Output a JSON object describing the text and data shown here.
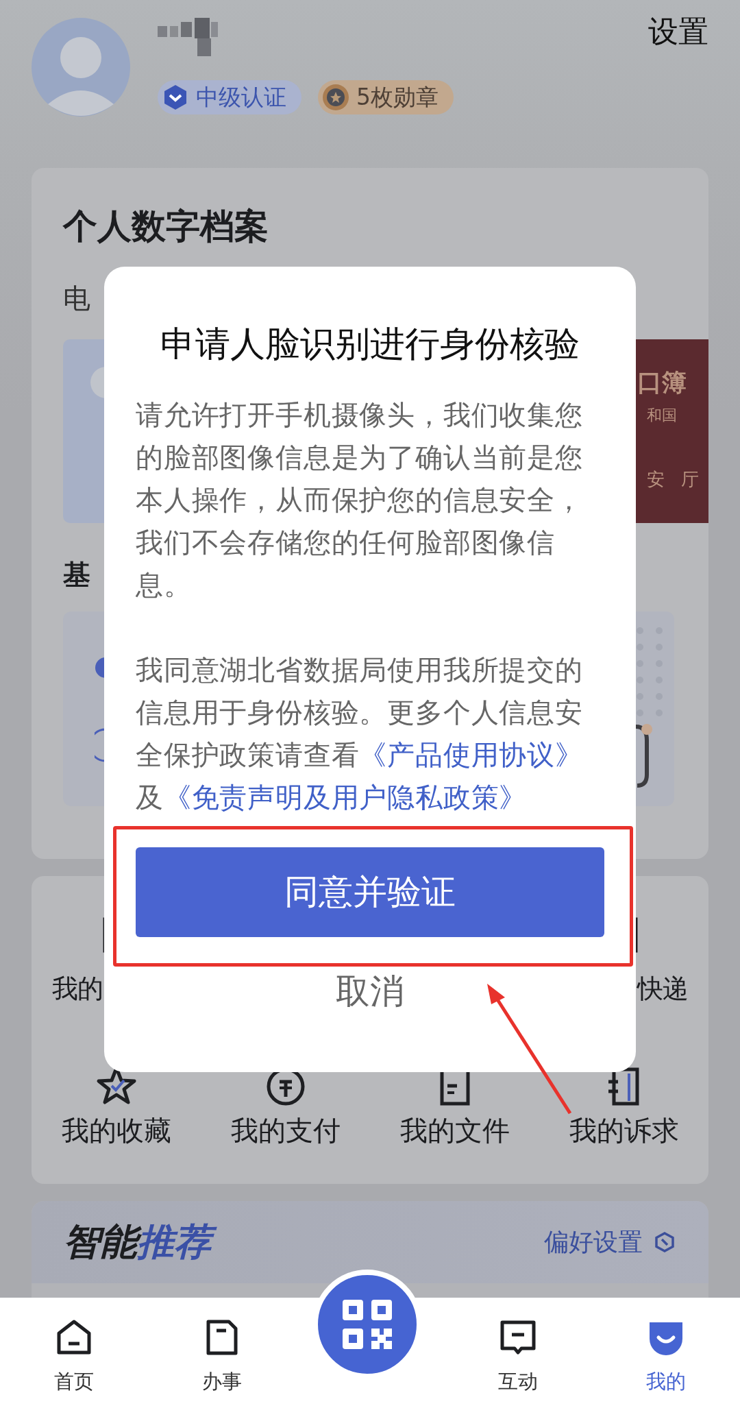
{
  "header": {
    "settings": "设置",
    "badges": [
      {
        "kind": "certification",
        "label": "中级认证"
      },
      {
        "kind": "medal",
        "label": "5枚勋章"
      }
    ]
  },
  "archive": {
    "title": "个人数字档案",
    "section_label": "电",
    "household_card": [
      "口簿",
      "和国",
      "安 厅"
    ],
    "subsection_label": "基"
  },
  "services": {
    "row_1": [
      "我的",
      "快递"
    ],
    "row_2": [
      "我的收藏",
      "我的支付",
      "我的文件",
      "我的诉求"
    ]
  },
  "recommend": {
    "title": [
      {
        "kind": "plain",
        "text": "智能"
      },
      {
        "kind": "accent",
        "text": "推荐"
      }
    ],
    "preference": "偏好设置"
  },
  "dialog": {
    "title": "申请人脸识别进行身份核验",
    "paragraphs": [
      [
        {
          "kind": "plain",
          "text": "请允许打开手机摄像头，我们收集您的脸部图像信息是为了确认当前是您本人操作，从而保护您的信息安全，我们不会存储您的任何脸部图像信息。"
        }
      ],
      [
        {
          "kind": "plain",
          "text": "我同意湖北省数据局使用我所提交的信息用于身份核验。更多个人信息安全保护政策请查看"
        },
        {
          "kind": "link",
          "text": "《产品使用协议》"
        },
        {
          "kind": "plain",
          "text": "及"
        },
        {
          "kind": "link",
          "text": "《免责声明及用户隐私政策》"
        }
      ]
    ],
    "confirm": "同意并验证",
    "cancel": "取消"
  },
  "nav": {
    "tabs": [
      {
        "label": "首页",
        "selected": false
      },
      {
        "label": "办事",
        "selected": false
      },
      {
        "label": "互动",
        "selected": false
      },
      {
        "label": "我的",
        "selected": true
      }
    ]
  }
}
